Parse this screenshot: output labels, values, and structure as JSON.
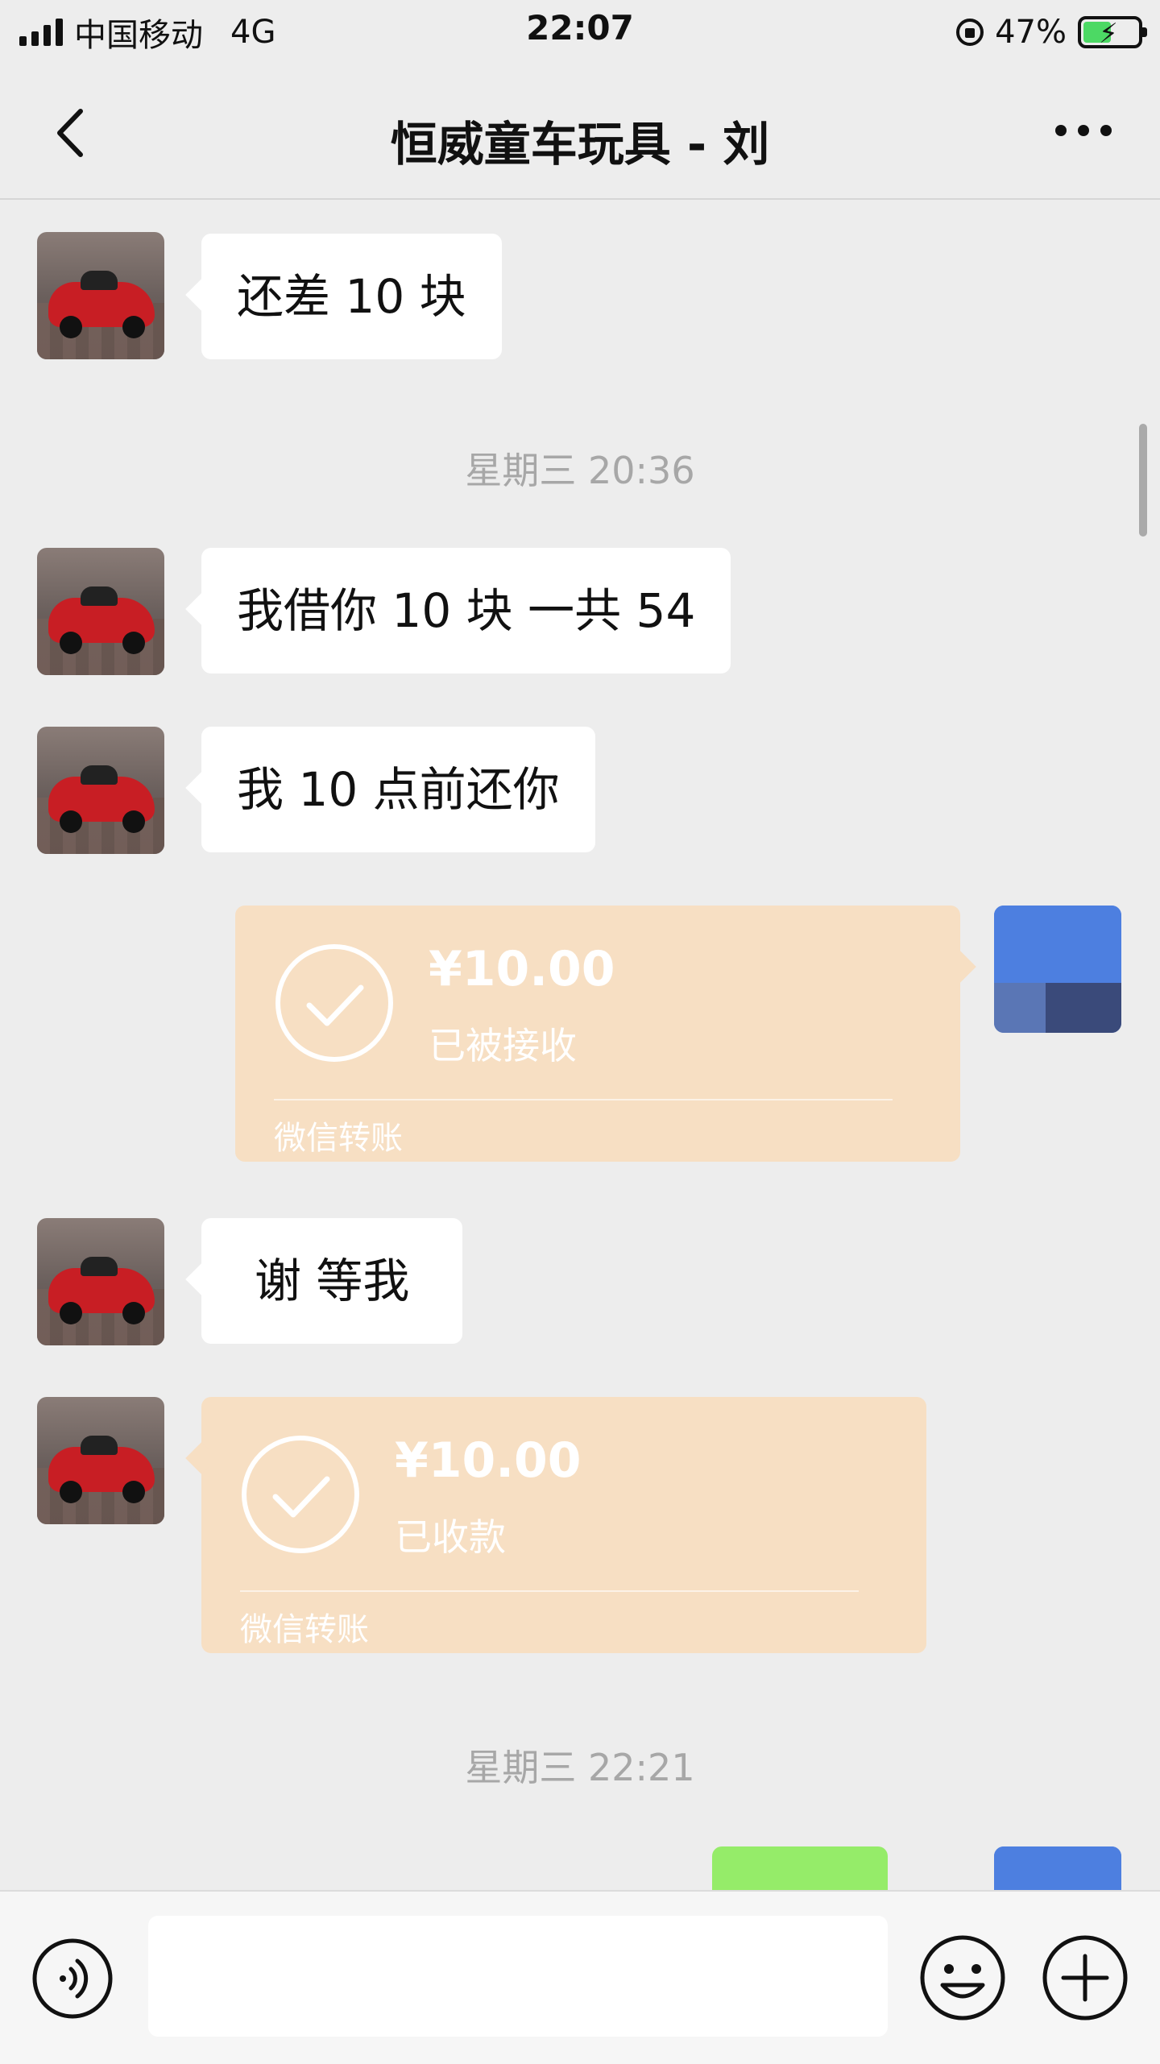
{
  "status_bar": {
    "carrier": "中国移动",
    "network": "4G",
    "time": "22:07",
    "battery_percent": "47%"
  },
  "nav": {
    "title": "恒威童车玩具 - 刘",
    "back_icon": "chevron-left-icon",
    "more_icon": "more-dots-icon"
  },
  "messages": [
    {
      "type": "text",
      "side": "left",
      "text": "还差 10 块"
    },
    {
      "type": "time",
      "text": "星期三 20:36"
    },
    {
      "type": "text",
      "side": "left",
      "text": "我借你 10 块 一共 54"
    },
    {
      "type": "text",
      "side": "left",
      "text": "我 10 点前还你"
    },
    {
      "type": "transfer",
      "side": "right",
      "amount": "¥10.00",
      "status": "已被接收",
      "label": "微信转账"
    },
    {
      "type": "text",
      "side": "left",
      "text": "谢 等我"
    },
    {
      "type": "transfer",
      "side": "left",
      "amount": "¥10.00",
      "status": "已收款",
      "label": "微信转账"
    },
    {
      "type": "time",
      "text": "星期三 22:21"
    }
  ],
  "input_bar": {
    "voice_icon": "voice-icon",
    "text_value": "",
    "emoji_icon": "emoji-icon",
    "plus_icon": "plus-icon"
  },
  "colors": {
    "background": "#ededed",
    "bubble_white": "#ffffff",
    "bubble_green": "#95ec69",
    "transfer_bg": "#f7dfc3",
    "timestamp_text": "#a7a7a7"
  }
}
